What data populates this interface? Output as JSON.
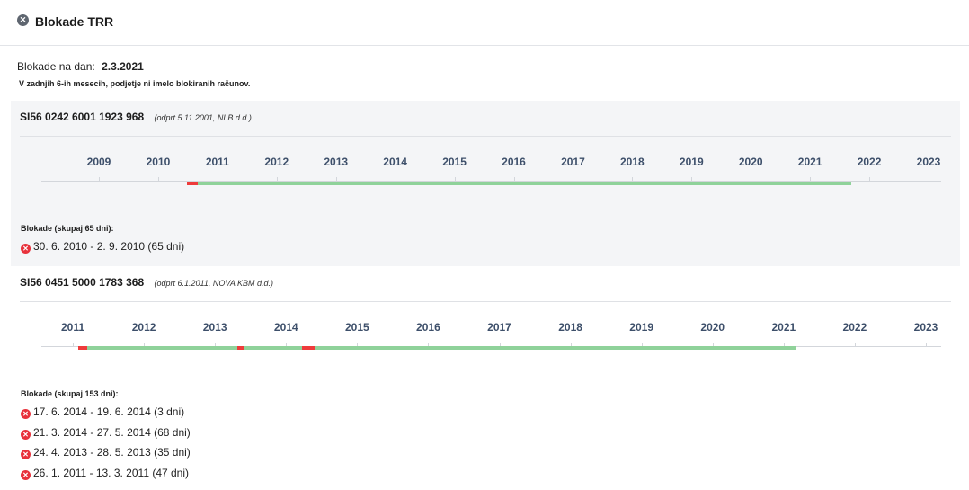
{
  "header": {
    "title": "Blokade TRR"
  },
  "summary": {
    "date_label": "Blokade na dan:",
    "date_value": "2.3.2021",
    "note": "V zadnjih 6-ih mesecih, podjetje ni imelo blokiranih računov."
  },
  "colors": {
    "ok": "#8fd29a",
    "blocked": "#ee3b3b",
    "axis_text": "#3d4f6a"
  },
  "accounts": [
    {
      "number": "SI56 0242 6001 1923 968",
      "meta": "(odprt 5.11.2001, NLB d.d.)",
      "axis_years": [
        "2009",
        "2010",
        "2011",
        "2012",
        "2013",
        "2014",
        "2015",
        "2016",
        "2017",
        "2018",
        "2019",
        "2020",
        "2021",
        "2022",
        "2023"
      ],
      "timeline": {
        "start": 2010.55,
        "end": 2021.7,
        "blocks": [
          {
            "from": 2010.49,
            "to": 2010.67
          }
        ]
      },
      "blocks_title": "Blokade (skupaj 65 dni):",
      "blocks": [
        "30. 6. 2010 - 2. 9. 2010 (65 dni)"
      ]
    },
    {
      "number": "SI56 0451 5000 1783 368",
      "meta": "(odprt 6.1.2011, NOVA KBM d.d.)",
      "axis_years": [
        "2011",
        "2012",
        "2013",
        "2014",
        "2015",
        "2016",
        "2017",
        "2018",
        "2019",
        "2020",
        "2021",
        "2022",
        "2023"
      ],
      "timeline": {
        "start": 2011.07,
        "end": 2021.17,
        "blocks": [
          {
            "from": 2011.07,
            "to": 2011.2
          },
          {
            "from": 2013.31,
            "to": 2013.4
          },
          {
            "from": 2014.22,
            "to": 2014.4
          }
        ]
      },
      "blocks_title": "Blokade (skupaj 153 dni):",
      "blocks": [
        "17. 6. 2014 - 19. 6. 2014 (3 dni)",
        "21. 3. 2014 - 27. 5. 2014 (68 dni)",
        "24. 4. 2013 - 28. 5. 2013 (35 dni)",
        "26. 1. 2011 - 13. 3. 2011 (47 dni)"
      ]
    }
  ]
}
